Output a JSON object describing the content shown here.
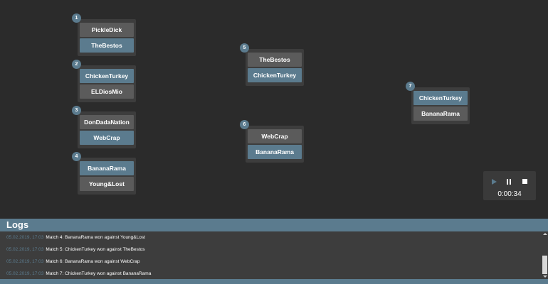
{
  "matches": [
    {
      "num": "1",
      "top": "PickleDick",
      "bottom": "TheBestos"
    },
    {
      "num": "2",
      "top": "ChickenTurkey",
      "bottom": "ELDiosMio"
    },
    {
      "num": "3",
      "top": "DonDadaNation",
      "bottom": "WebCrap"
    },
    {
      "num": "4",
      "top": "BananaRama",
      "bottom": "Young&Lost"
    },
    {
      "num": "5",
      "top": "TheBestos",
      "bottom": "ChickenTurkey"
    },
    {
      "num": "6",
      "top": "WebCrap",
      "bottom": "BananaRama"
    },
    {
      "num": "7",
      "top": "ChickenTurkey",
      "bottom": "BananaRama"
    }
  ],
  "player": {
    "timer": "0:00:34"
  },
  "logs": {
    "title": "Logs",
    "entries": [
      {
        "time": "05.02.2019, 17:03",
        "message": "Match 4: BananaRama won against Young&Lost"
      },
      {
        "time": "05.02.2019, 17:03",
        "message": "Match 5: ChickenTurkey won against TheBestos"
      },
      {
        "time": "05.02.2019, 17:03",
        "message": "Match 6: BananaRama won against WebCrap"
      },
      {
        "time": "05.02.2019, 17:03",
        "message": "Match 7: ChickenTurkey won against BananaRama"
      }
    ]
  },
  "colors": {
    "accent": "#5b7b8e",
    "background": "#2b2b2b",
    "panel": "#3d3d3d",
    "slot": "#5b5b5b"
  }
}
